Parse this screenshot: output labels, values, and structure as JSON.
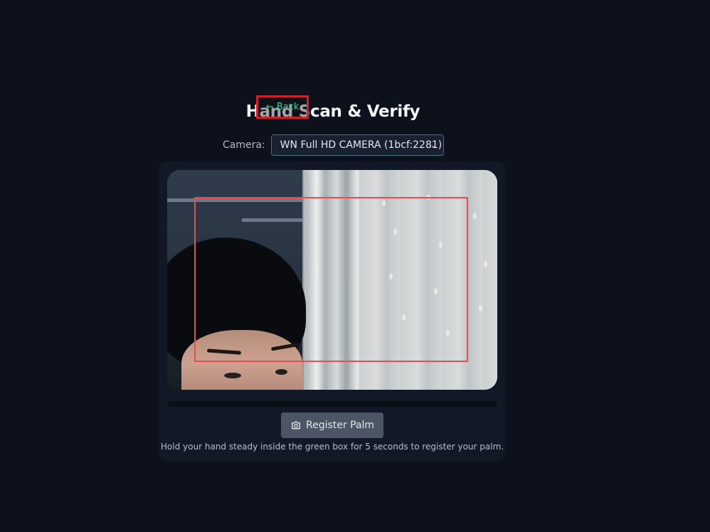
{
  "header": {
    "title": "Hand Scan & Verify",
    "back_label": "← Back"
  },
  "camera": {
    "label": "Camera:",
    "selected": "WN Full HD CAMERA (1bcf:2281)",
    "chevron": "⌄"
  },
  "scanner": {
    "register_label": "Register Palm",
    "hint": "Hold your hand steady inside the green box for 5 seconds to register your palm.",
    "progress_fraction": 0
  },
  "icons": {
    "camera": "camera-icon",
    "back": "left-arrow-icon",
    "dropdown": "chevron-down-icon"
  },
  "colors": {
    "background": "#0d111b",
    "panel": "#121826",
    "accent_green": "#3fd28b",
    "scan_box_red": "#e84b50",
    "select_border": "#277d8d",
    "button": "#4b5563"
  }
}
